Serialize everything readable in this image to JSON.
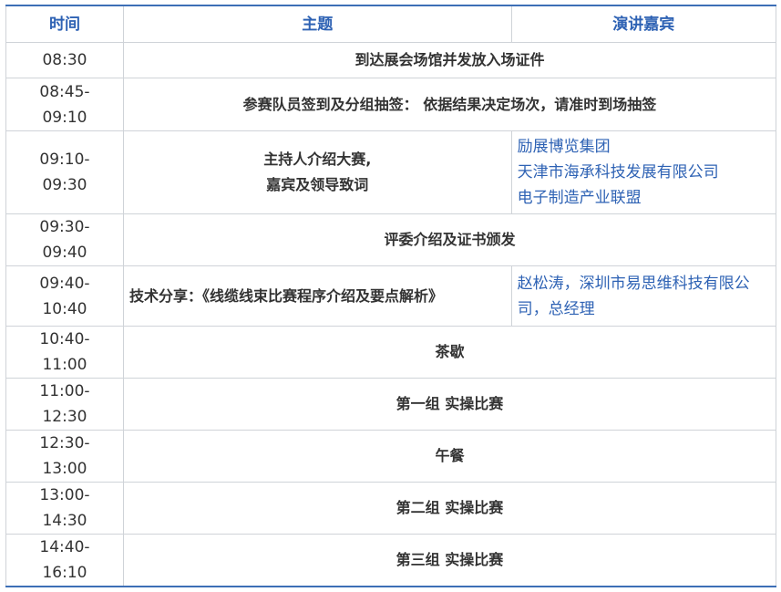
{
  "header": {
    "time": "时间",
    "topic": "主题",
    "speaker": "演讲嘉宾"
  },
  "rows": [
    {
      "time": [
        "08:30"
      ],
      "topic": [
        "到达展会场馆并发放入场证件"
      ]
    },
    {
      "time": [
        "08:45-",
        "09:10"
      ],
      "topic": [
        "参赛队员签到及分组抽签： 依据结果决定场次，请准时到场抽签"
      ]
    },
    {
      "time": [
        "09:10-",
        "09:30"
      ],
      "topic": [
        "主持人介绍大赛,",
        "嘉宾及领导致词"
      ],
      "speaker": [
        "励展博览集团",
        "天津市海承科技发展有限公司",
        "电子制造产业联盟"
      ]
    },
    {
      "time": [
        "09:30-",
        "09:40"
      ],
      "topic": [
        "评委介绍及证书颁发"
      ]
    },
    {
      "time": [
        "09:40-",
        "10:40"
      ],
      "topic": [
        "技术分享：《线缆线束比赛程序介绍及要点解析》"
      ],
      "speaker": [
        "赵松涛，深圳市易思维科技有限公",
        "司，总经理"
      ]
    },
    {
      "time": [
        "10:40-",
        "11:00"
      ],
      "topic": [
        "茶歇"
      ]
    },
    {
      "time": [
        "11:00-",
        "12:30"
      ],
      "topic": [
        "第一组 实操比赛"
      ]
    },
    {
      "time": [
        "12:30-",
        "13:00"
      ],
      "topic": [
        "午餐"
      ]
    },
    {
      "time": [
        "13:00-",
        "14:30"
      ],
      "topic": [
        "第二组 实操比赛"
      ]
    },
    {
      "time": [
        "14:40-",
        "16:10"
      ],
      "topic": [
        "第三组 实操比赛"
      ]
    }
  ],
  "colors": {
    "accent": "#2e62b4",
    "rule": "#3d6fb6",
    "border": "#cfd3d8",
    "text": "#333333"
  }
}
